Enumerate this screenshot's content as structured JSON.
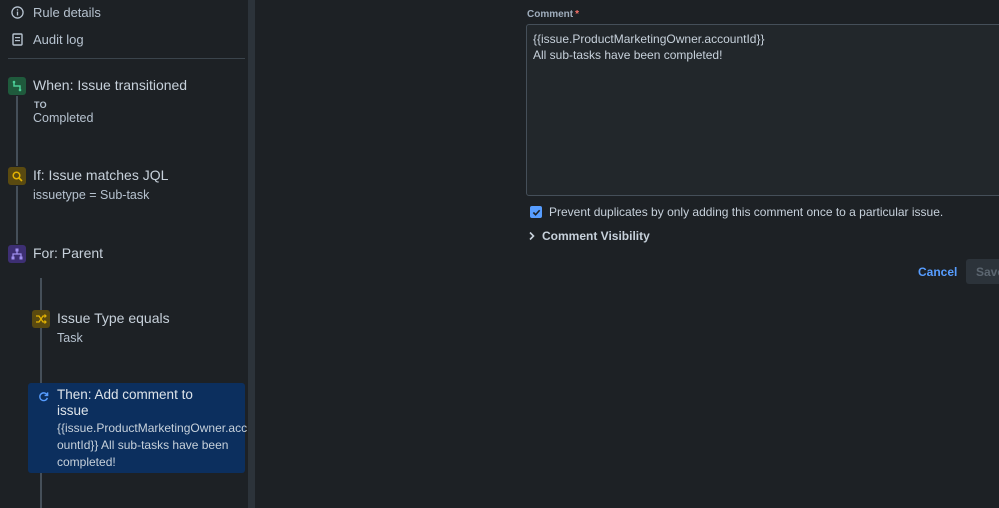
{
  "nav": {
    "rule_details": "Rule details",
    "audit_log": "Audit log"
  },
  "steps": {
    "trigger": {
      "title": "When: Issue transitioned",
      "to_label": "TO",
      "value": "Completed"
    },
    "condition": {
      "title": "If: Issue matches JQL",
      "value": "issuetype = Sub-task"
    },
    "branch": {
      "title": "For: Parent"
    },
    "nested_condition": {
      "title": "Issue Type equals",
      "value": "Task"
    },
    "action": {
      "title_line1": "Then: Add comment to",
      "title_line2": "issue",
      "value": "{{issue.ProductMarketingOwner.acc\nountId}} All sub-tasks have been\ncompleted!"
    }
  },
  "form": {
    "comment_label": "Comment",
    "required_mark": "*",
    "comment_value": "{{issue.ProductMarketingOwner.accountId}}\nAll sub-tasks have been completed!",
    "prevent_duplicates_label": "Prevent duplicates by only adding this comment once to a particular issue.",
    "prevent_duplicates_checked": true,
    "visibility_label": "Comment Visibility",
    "cancel_label": "Cancel",
    "save_label": "Save"
  },
  "colors": {
    "trigger_badge": "#1f5a3c",
    "condition_badge": "#5a4a10",
    "branch_badge": "#3d2f73",
    "action_selected": "#0c2f5e",
    "accent": "#579dff"
  }
}
